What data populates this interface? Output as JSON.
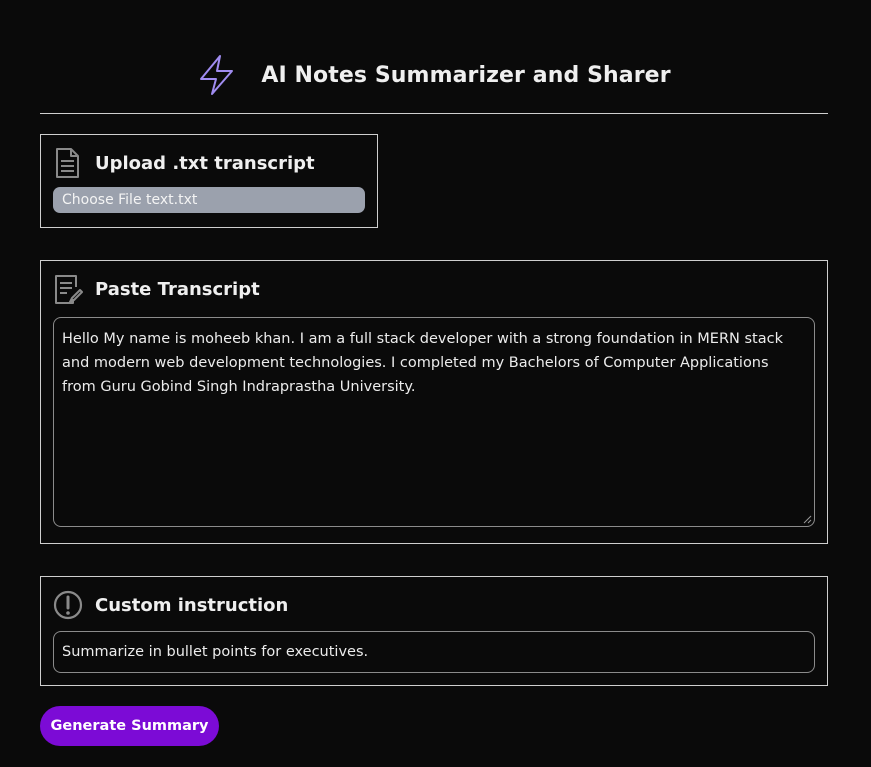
{
  "header": {
    "title": "AI Notes Summarizer and Sharer",
    "icon": "lightning-bolt-icon",
    "icon_color": "#a08cf0"
  },
  "upload": {
    "title": "Upload .txt transcript",
    "icon": "document-icon",
    "file_input_text": "Choose File text.txt"
  },
  "paste": {
    "title": "Paste Transcript",
    "icon": "document-edit-icon",
    "transcript": "Hello My name is moheeb khan. I am a full stack developer with a strong foundation in MERN stack and modern web development technologies. I completed my Bachelors of Computer Applications from Guru Gobind Singh Indraprastha University."
  },
  "custom": {
    "title": "Custom instruction",
    "icon": "alert-circle-icon",
    "instruction": "Summarize in bullet points for executives."
  },
  "actions": {
    "generate_label": "Generate Summary",
    "button_color": "#7c0bd6"
  }
}
